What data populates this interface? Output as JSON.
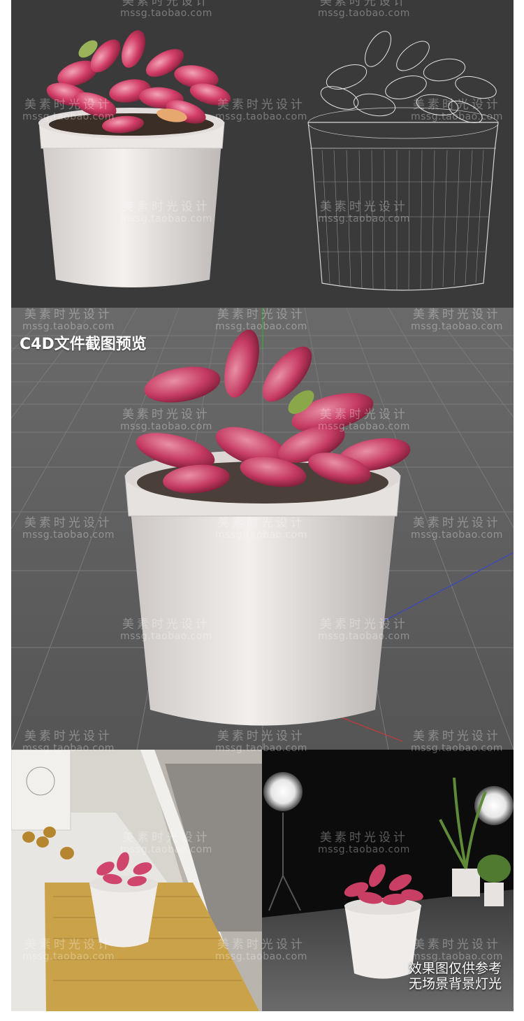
{
  "preview_title": "C4D文件截图预览",
  "caption": {
    "line1": "效果图仅供参考",
    "line2": "无场景背景灯光"
  },
  "watermark": {
    "cn": "美素时光设计",
    "url": "mssg.taobao.com"
  },
  "colors": {
    "leaf": "#d0456b",
    "pot": "#e9e5e3",
    "viewport_bg": "#3a3a3a",
    "grid_bg": "#5e5e5e"
  }
}
